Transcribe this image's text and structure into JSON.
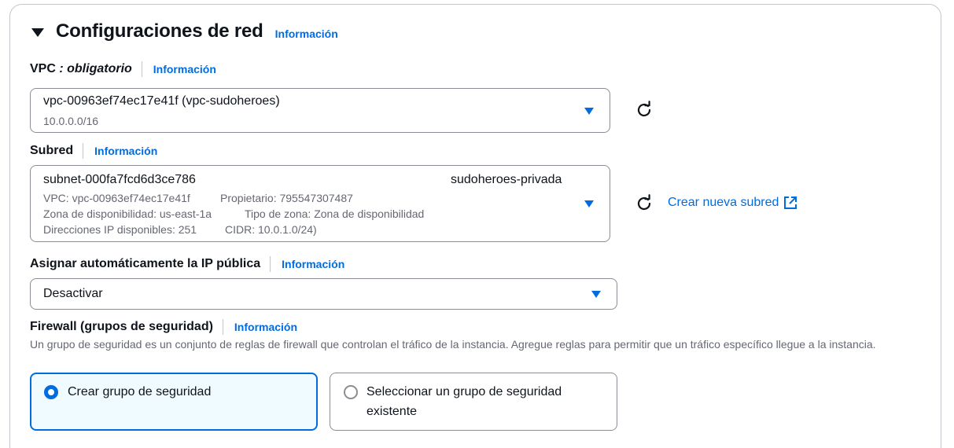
{
  "section": {
    "title": "Configuraciones de red",
    "info": "Información"
  },
  "vpc": {
    "label": "VPC",
    "label_required": " : obligatorio",
    "info": "Información",
    "selected": "vpc-00963ef74ec17e41f (vpc-sudoheroes)",
    "cidr": "10.0.0.0/16"
  },
  "subnet": {
    "label": "Subred",
    "info": "Información",
    "selected": "subnet-000fa7fcd6d3ce786",
    "name": "sudoheroes-privada",
    "vpc_line": "VPC: vpc-00963ef74ec17e41f",
    "owner_line": "Propietario: 795547307487",
    "az_line": "Zona de disponibilidad: us-east-1a",
    "zone_type_line": "Tipo de zona: Zona de disponibilidad",
    "ips_line": "Direcciones IP disponibles: 251",
    "cidr_line": "CIDR: 10.0.1.0/24)",
    "create_link": "Crear nueva subred"
  },
  "public_ip": {
    "label": "Asignar automáticamente la IP pública",
    "info": "Información",
    "selected": "Desactivar"
  },
  "firewall": {
    "label": "Firewall (grupos de seguridad)",
    "info": "Información",
    "description": "Un grupo de seguridad es un conjunto de reglas de firewall que controlan el tráfico de la instancia. Agregue reglas para permitir que un tráfico específico llegue a la instancia.",
    "options": [
      {
        "label": "Crear grupo de seguridad",
        "selected": true
      },
      {
        "label": "Seleccionar un grupo de seguridad existente",
        "selected": false
      }
    ]
  },
  "icons": {
    "section_toggle": "caret-down-icon",
    "refresh": "refresh-icon",
    "external": "external-link-icon",
    "dropdown": "caret-down-icon"
  },
  "colors": {
    "link": "#006ce0",
    "selected_tile_bg": "#f0fbff",
    "text": "#0f141a",
    "secondary_text": "#656871"
  }
}
